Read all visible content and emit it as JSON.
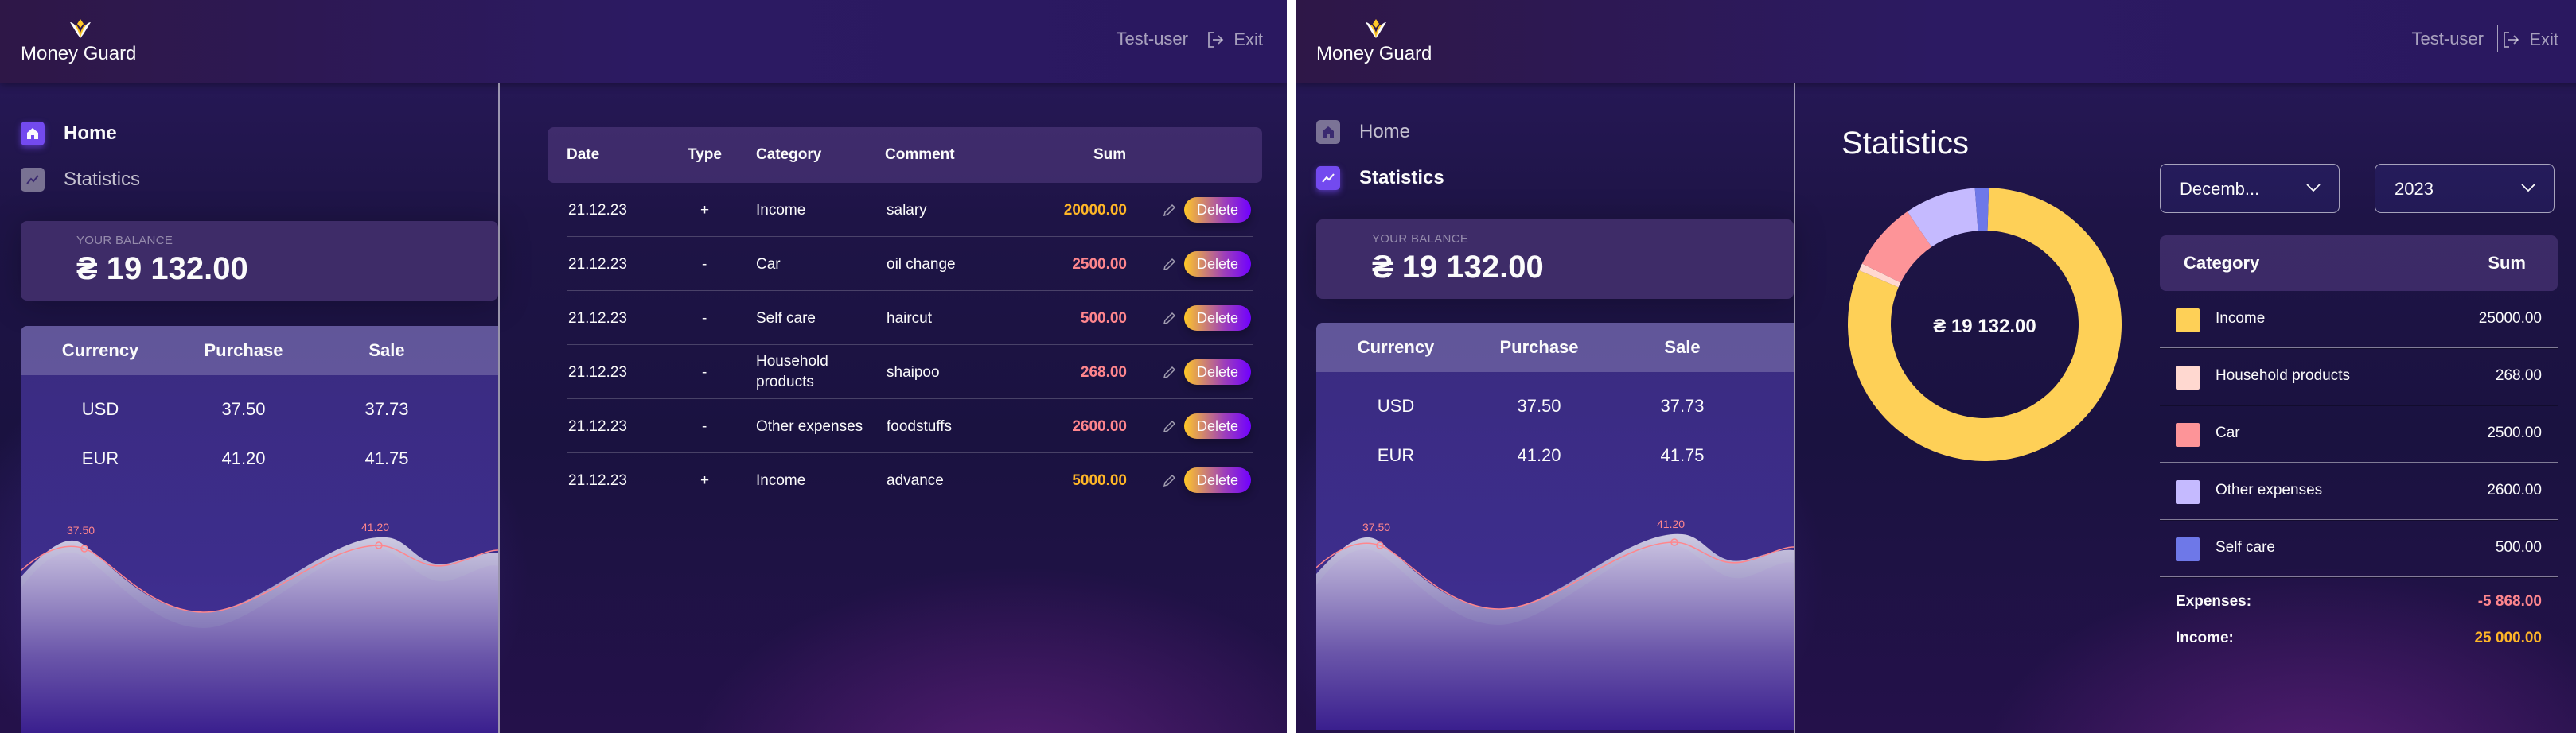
{
  "app": {
    "logo_text": "Money Guard",
    "user_name": "Test-user",
    "exit_label": "Exit"
  },
  "nav": {
    "home_label": "Home",
    "statistics_label": "Statistics"
  },
  "balance": {
    "label": "Your balance",
    "value": "₴ 19 132.00"
  },
  "currency": {
    "headers": {
      "currency": "Currency",
      "purchase": "Purchase",
      "sale": "Sale"
    },
    "rows": [
      {
        "code": "USD",
        "purchase": "37.50",
        "sale": "37.73"
      },
      {
        "code": "EUR",
        "purchase": "41.20",
        "sale": "41.75"
      }
    ],
    "chart_labels": {
      "usd_purchase": "37.50",
      "eur_purchase": "41.20"
    }
  },
  "transactions": {
    "headers": {
      "date": "Date",
      "type": "Type",
      "category": "Category",
      "comment": "Comment",
      "sum": "Sum"
    },
    "delete_label": "Delete",
    "rows": [
      {
        "date": "21.12.23",
        "type": "+",
        "category": "Income",
        "category_line2": "",
        "comment": "salary",
        "sum": "20000.00",
        "kind": "income"
      },
      {
        "date": "21.12.23",
        "type": "-",
        "category": "Car",
        "category_line2": "",
        "comment": "oil change",
        "sum": "2500.00",
        "kind": "expense"
      },
      {
        "date": "21.12.23",
        "type": "-",
        "category": "Self care",
        "category_line2": "",
        "comment": "haircut",
        "sum": "500.00",
        "kind": "expense"
      },
      {
        "date": "21.12.23",
        "type": "-",
        "category": "Household",
        "category_line2": "products",
        "comment": "shaipoo",
        "sum": "268.00",
        "kind": "expense"
      },
      {
        "date": "21.12.23",
        "type": "-",
        "category": "Other expenses",
        "category_line2": "",
        "comment": "foodstuffs",
        "sum": "2600.00",
        "kind": "expense"
      },
      {
        "date": "21.12.23",
        "type": "+",
        "category": "Income",
        "category_line2": "",
        "comment": "advance",
        "sum": "5000.00",
        "kind": "income"
      }
    ]
  },
  "statistics": {
    "title": "Statistics",
    "month_select": "Decemb...",
    "year_select": "2023",
    "center_balance": "₴ 19 132.00",
    "table_headers": {
      "category": "Category",
      "sum": "Sum"
    },
    "categories": [
      {
        "name": "Income",
        "sum": "25000.00",
        "color": "#fed057"
      },
      {
        "name": "Household products",
        "sum": "268.00",
        "color": "#ffd8d0"
      },
      {
        "name": "Car",
        "sum": "2500.00",
        "color": "#fd9498"
      },
      {
        "name": "Other expenses",
        "sum": "2600.00",
        "color": "#c5baff"
      },
      {
        "name": "Self care",
        "sum": "500.00",
        "color": "#6e78e8"
      }
    ],
    "expenses_label": "Expenses:",
    "expenses_value": "-5 868.00",
    "income_label": "Income:",
    "income_value": "25 000.00"
  },
  "chart_data": {
    "type": "pie",
    "categories": [
      "Income",
      "Household products",
      "Car",
      "Other expenses",
      "Self care"
    ],
    "values": [
      25000,
      268,
      2500,
      2600,
      500
    ],
    "colors": [
      "#fed057",
      "#ffd8d0",
      "#fd9498",
      "#c5baff",
      "#6e78e8"
    ]
  },
  "colors": {
    "income": "#ffb627",
    "expense": "#ff868d",
    "accent": "#734aef"
  }
}
